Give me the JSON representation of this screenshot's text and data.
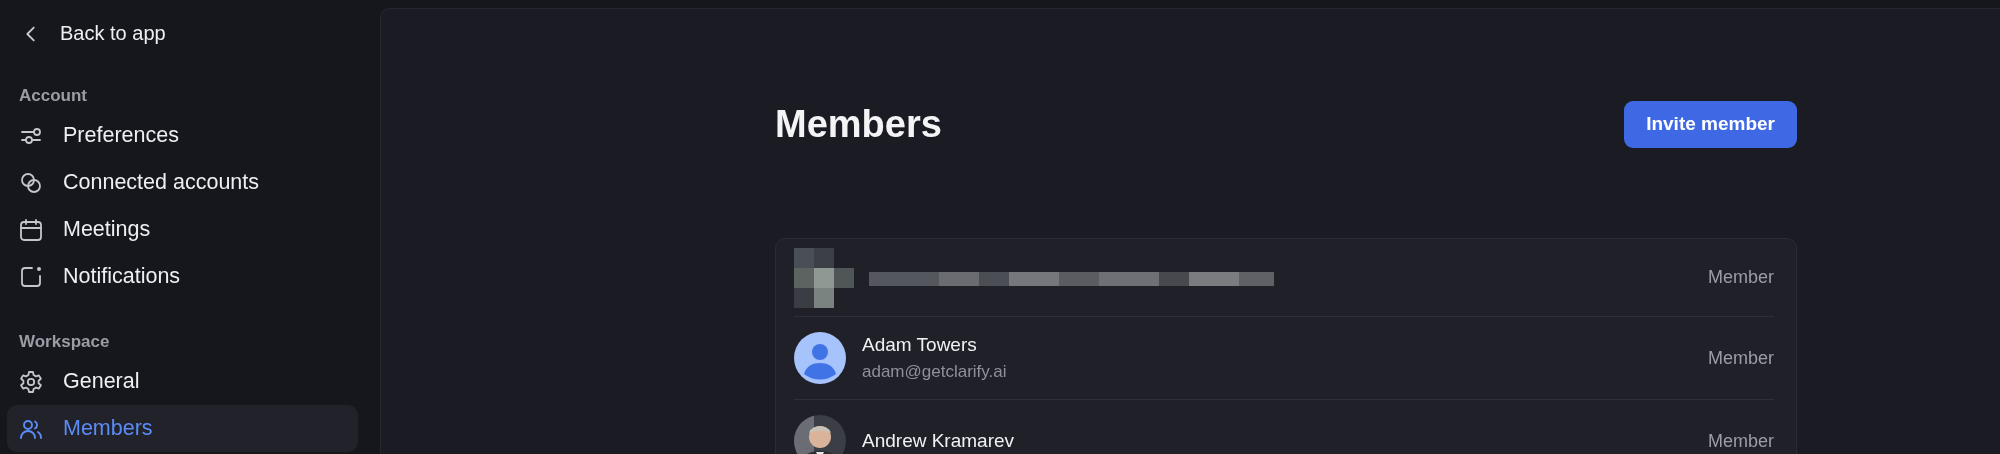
{
  "sidebar": {
    "back_link": "Back to app",
    "sections": [
      {
        "heading": "Account",
        "items": [
          {
            "label": "Preferences",
            "kind": "sliders",
            "selected": false
          },
          {
            "label": "Connected accounts",
            "kind": "rings",
            "selected": false
          },
          {
            "label": "Meetings",
            "kind": "calendar",
            "selected": false
          },
          {
            "label": "Notifications",
            "kind": "notification",
            "selected": false
          }
        ]
      },
      {
        "heading": "Workspace",
        "items": [
          {
            "label": "General",
            "kind": "gear",
            "selected": false
          },
          {
            "label": "Members",
            "kind": "people",
            "selected": true
          }
        ]
      }
    ]
  },
  "page": {
    "title": "Members",
    "invite_button": "Invite member"
  },
  "members": [
    {
      "kind": "redacted",
      "role": "Member"
    },
    {
      "kind": "default_avatar",
      "name": "Adam Towers",
      "email": "adam@getclarify.ai",
      "role": "Member"
    },
    {
      "name": "Andrew Kramarev",
      "role": "Member"
    }
  ]
}
